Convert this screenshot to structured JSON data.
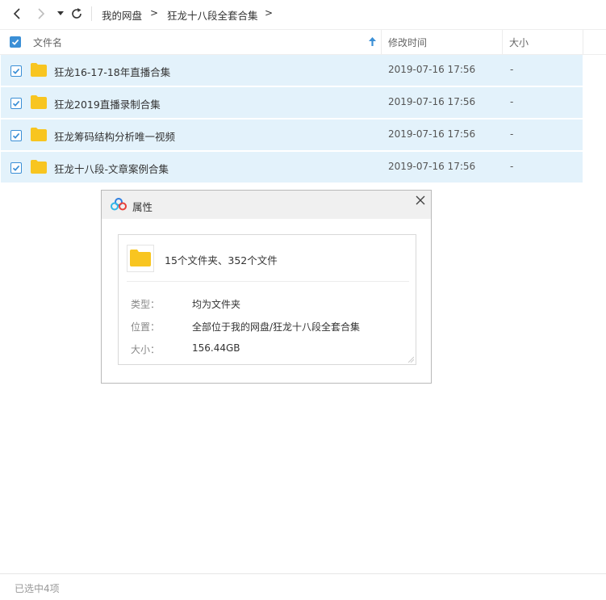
{
  "breadcrumb": [
    "我的网盘",
    "狂龙十八段全套合集"
  ],
  "breadcrumb_separator": ">",
  "columns": {
    "name": "文件名",
    "modified": "修改时间",
    "size": "大小"
  },
  "files": [
    {
      "name": "狂龙16-17-18年直播合集",
      "modified": "2019-07-16 17:56",
      "size": "-"
    },
    {
      "name": "狂龙2019直播录制合集",
      "modified": "2019-07-16 17:56",
      "size": "-"
    },
    {
      "name": "狂龙筹码结构分析唯一视频",
      "modified": "2019-07-16 17:56",
      "size": "-"
    },
    {
      "name": "狂龙十八段-文章案例合集",
      "modified": "2019-07-16 17:56",
      "size": "-"
    }
  ],
  "dialog": {
    "title": "属性",
    "summary": "15个文件夹、352个文件",
    "props": [
      {
        "label": "类型：",
        "value": "均为文件夹"
      },
      {
        "label": "位置：",
        "value": "全部位于我的网盘/狂龙十八段全套合集"
      },
      {
        "label": "大小：",
        "value": "156.44GB"
      }
    ]
  },
  "status": "已选中4项",
  "colors": {
    "accent": "#3b8fd6",
    "selected_row": "#e3f2fb",
    "folder": "#f8c520"
  },
  "icons": [
    "back-arrow-icon",
    "forward-arrow-icon",
    "dropdown-caret-icon",
    "refresh-icon",
    "sort-ascending-icon",
    "folder-icon",
    "close-icon",
    "baidu-cloud-logo-icon",
    "checkmark-icon"
  ]
}
